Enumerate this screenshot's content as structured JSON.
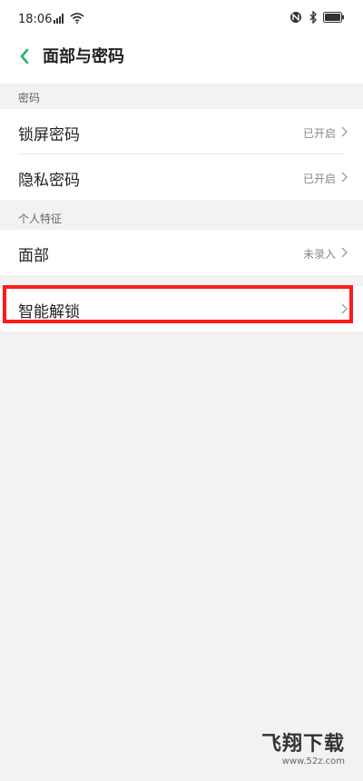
{
  "status_bar": {
    "time": "18:06",
    "icons": [
      "signal-icon",
      "wifi-icon",
      "nfc-icon",
      "bluetooth-icon",
      "battery-icon"
    ]
  },
  "header": {
    "back_icon": "chevron-left-icon",
    "title": "面部与密码"
  },
  "sections": [
    {
      "header": "密码",
      "items": [
        {
          "label": "锁屏密码",
          "value": "已开启"
        },
        {
          "label": "隐私密码",
          "value": "已开启"
        }
      ]
    },
    {
      "header": "个人特征",
      "items": [
        {
          "label": "面部",
          "value": "未录入"
        }
      ]
    },
    {
      "items": [
        {
          "label": "智能解锁",
          "value": ""
        }
      ]
    }
  ],
  "watermark": {
    "text": "飞翔下载",
    "url": "www.52z.com"
  },
  "colors": {
    "accent": "#27b36a",
    "highlight": "#ff1a1a",
    "background": "#f2f2f2"
  }
}
